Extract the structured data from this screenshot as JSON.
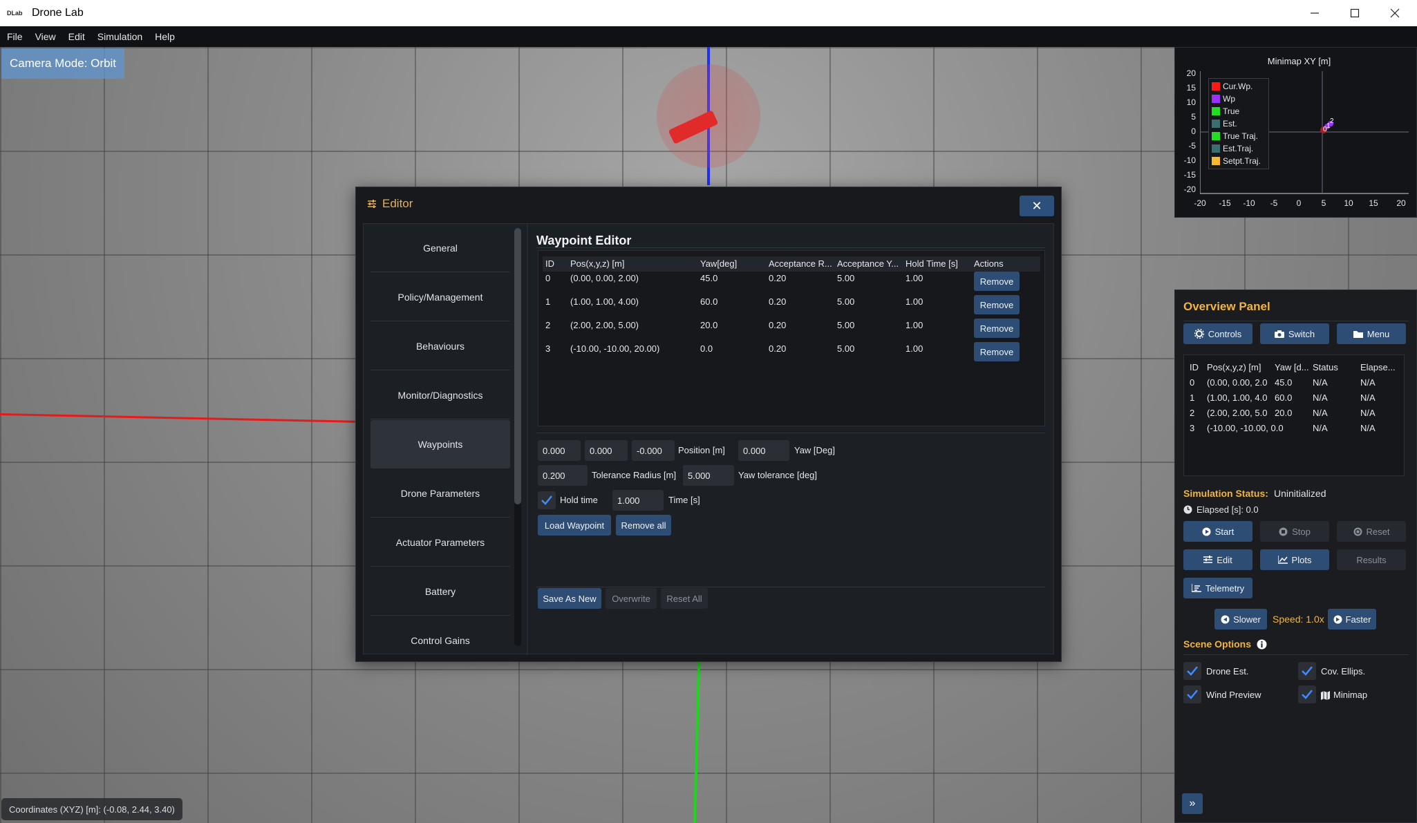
{
  "window": {
    "title": "Drone Lab",
    "logo_text": "DLab"
  },
  "menubar": {
    "items": [
      "File",
      "View",
      "Edit",
      "Simulation",
      "Help"
    ]
  },
  "viewport": {
    "camera_mode": "Camera Mode: Orbit",
    "coordinates": "Coordinates (XYZ) [m]: (-0.08, 2.44, 3.40)"
  },
  "editor": {
    "title": "Editor",
    "close_label": "✕",
    "sidebar": [
      "General",
      "Policy/Management",
      "Behaviours",
      "Monitor/Diagnostics",
      "Waypoints",
      "Drone Parameters",
      "Actuator Parameters",
      "Battery",
      "Control Gains"
    ],
    "active_item": "Waypoints",
    "waypoint_editor": {
      "title": "Waypoint Editor",
      "columns": [
        "ID",
        "Pos(x,y,z) [m]",
        "Yaw[deg]",
        "Acceptance R...",
        "Acceptance Y...",
        "Hold Time [s]",
        "Actions"
      ],
      "rows": [
        {
          "id": "0",
          "pos": "(0.00, 0.00, 2.00)",
          "yaw": "45.0",
          "acc_r": "0.20",
          "acc_y": "5.00",
          "hold": "1.00",
          "action": "Remove"
        },
        {
          "id": "1",
          "pos": "(1.00, 1.00, 4.00)",
          "yaw": "60.0",
          "acc_r": "0.20",
          "acc_y": "5.00",
          "hold": "1.00",
          "action": "Remove"
        },
        {
          "id": "2",
          "pos": "(2.00, 2.00, 5.00)",
          "yaw": "20.0",
          "acc_r": "0.20",
          "acc_y": "5.00",
          "hold": "1.00",
          "action": "Remove"
        },
        {
          "id": "3",
          "pos": "(-10.00, -10.00, 20.00)",
          "yaw": "0.0",
          "acc_r": "0.20",
          "acc_y": "5.00",
          "hold": "1.00",
          "action": "Remove"
        }
      ],
      "inputs": {
        "pos_x": "0.000",
        "pos_y": "0.000",
        "pos_z": "-0.000",
        "position_label": "Position [m]",
        "yaw": "0.000",
        "yaw_label": "Yaw [Deg]",
        "tolerance_radius": "0.200",
        "tolerance_radius_label": "Tolerance Radius [m]",
        "yaw_tolerance": "5.000",
        "yaw_tolerance_label": "Yaw tolerance [deg]",
        "hold_time_label": "Hold time",
        "hold_time_checked": true,
        "time": "1.000",
        "time_label": "Time [s]"
      },
      "buttons": {
        "load_waypoint": "Load Waypoint",
        "remove_all": "Remove all",
        "save_as_new": "Save As New",
        "overwrite": "Overwrite",
        "reset_all": "Reset All"
      }
    }
  },
  "minimap": {
    "title": "Minimap XY [m]",
    "legend": [
      {
        "label": "Cur.Wp.",
        "color": "#ff1a1a"
      },
      {
        "label": "Wp",
        "color": "#9b30ff"
      },
      {
        "label": "True",
        "color": "#22dd22"
      },
      {
        "label": "Est.",
        "color": "#3b6f6f"
      },
      {
        "label": "True Traj.",
        "color": "#22dd22"
      },
      {
        "label": "Est.Traj.",
        "color": "#3b6f6f"
      },
      {
        "label": "Setpt.Traj.",
        "color": "#f5b82e"
      }
    ],
    "y_ticks": [
      "20",
      "15",
      "10",
      "5",
      "0",
      "-5",
      "-10",
      "-15",
      "-20"
    ],
    "x_ticks": [
      "-20",
      "-15",
      "-10",
      "-5",
      "0",
      "5",
      "10",
      "15",
      "20"
    ],
    "point_labels": [
      "0",
      "1",
      "2"
    ]
  },
  "overview": {
    "title": "Overview Panel",
    "top_buttons": [
      "Controls",
      "Switch",
      "Menu"
    ],
    "columns": [
      "ID",
      "Pos(x,y,z) [m]",
      "Yaw [d...",
      "Status",
      "Elapse..."
    ],
    "rows": [
      {
        "id": "0",
        "pos": "(0.00, 0.00, 2.0",
        "yaw": "45.0",
        "status": "N/A",
        "elapsed": "N/A"
      },
      {
        "id": "1",
        "pos": "(1.00, 1.00, 4.0",
        "yaw": "60.0",
        "status": "N/A",
        "elapsed": "N/A"
      },
      {
        "id": "2",
        "pos": "(2.00, 2.00, 5.0",
        "yaw": "20.0",
        "status": "N/A",
        "elapsed": "N/A"
      },
      {
        "id": "3",
        "pos": "(-10.00, -10.00, 0.0",
        "yaw": "",
        "status": "N/A",
        "elapsed": "N/A"
      }
    ],
    "status_label": "Simulation Status:",
    "status_value": "Uninitialized",
    "elapsed": "Elapsed [s]: 0.0",
    "sim_buttons": {
      "start": "Start",
      "stop": "Stop",
      "reset": "Reset",
      "edit": "Edit",
      "plots": "Plots",
      "results": "Results",
      "telemetry": "Telemetry"
    },
    "speed_buttons": {
      "slower": "Slower",
      "faster": "Faster"
    },
    "speed": "Speed: 1.0x",
    "scene_options_title": "Scene Options",
    "scene_options": {
      "drone_est": "Drone Est.",
      "cov_ellips": "Cov. Ellips.",
      "wind_preview": "Wind Preview",
      "minimap": "Minimap"
    },
    "expand": "»"
  }
}
